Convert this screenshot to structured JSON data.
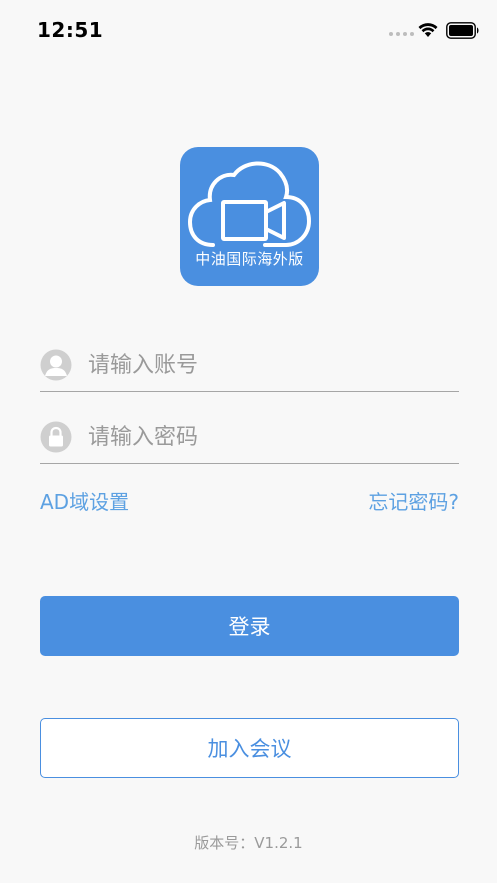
{
  "status_bar": {
    "time": "12:51",
    "icons": [
      "cellular-signal-icon",
      "wifi-icon",
      "battery-icon"
    ]
  },
  "logo": {
    "text": "中油国际海外版",
    "icon": "cloud-video-camera-icon",
    "color": "#4a8fe0"
  },
  "login_form": {
    "username": {
      "placeholder": "请输入账号",
      "value": "",
      "icon": "user-icon"
    },
    "password": {
      "placeholder": "请输入密码",
      "value": "",
      "icon": "lock-icon"
    },
    "ad_settings_link": "AD域设置",
    "forgot_password_link": "忘记密码?"
  },
  "buttons": {
    "login_label": "登录",
    "join_meeting_label": "加入会议"
  },
  "footer": {
    "version": "版本号：V1.2.1"
  },
  "colors": {
    "primary": "#4a8fe0",
    "link": "#5da1e2",
    "placeholder": "#9a9a9a",
    "background": "#f8f8f8"
  }
}
